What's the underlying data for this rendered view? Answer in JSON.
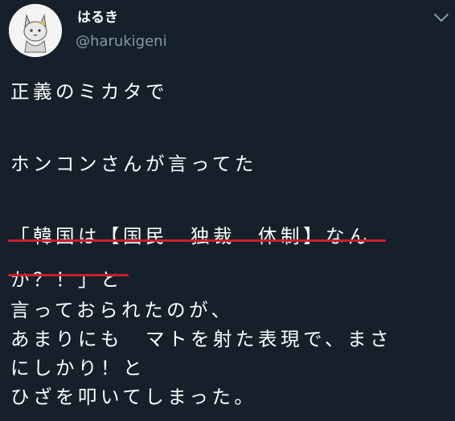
{
  "user": {
    "display_name": "はるき",
    "handle": "@harukigeni"
  },
  "icons": {
    "avatar": "cat-avatar-icon",
    "menu": "chevron-down-icon"
  },
  "colors": {
    "background": "#15202b",
    "text": "#ffffff",
    "secondary_text": "#8899a6",
    "highlight_underline": "#cc1f2b"
  },
  "tweet": {
    "lines": [
      "正義のミカタで",
      "ホンコンさんが言ってた",
      "「韓国は【国民　独裁　体制】なん",
      "か？！」と",
      "言っておられたのが、",
      "あまりにも　マトを射た表現で、まさ",
      "にしかり！と",
      "ひざを叩いてしまった。"
    ]
  }
}
